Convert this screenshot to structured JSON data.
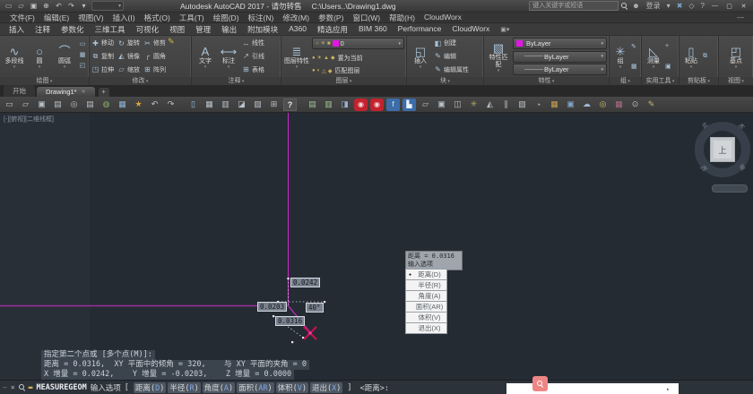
{
  "window": {
    "title": "Autodesk AutoCAD 2017 - 请勿转售",
    "doc_path": "C:\\Users..\\Drawing1.dwg",
    "search_placeholder": "键入关键字或短语",
    "signin": "登录",
    "user_icon": "☻",
    "caret": "▾",
    "x_icon": "✖",
    "cube_icon": "◇",
    "help": "?",
    "min": "—",
    "max": "▢",
    "close": "✕",
    "menubar_min": "—"
  },
  "quick_access": [
    {
      "g": "▭"
    },
    {
      "g": "▱"
    },
    {
      "g": "▣"
    },
    {
      "g": "⊕"
    },
    {
      "g": "↶"
    },
    {
      "g": "↷"
    },
    {
      "g": "▾"
    }
  ],
  "menu": {
    "items": [
      "文件(F)",
      "编辑(E)",
      "视图(V)",
      "插入(I)",
      "格式(O)",
      "工具(T)",
      "绘图(D)",
      "标注(N)",
      "修改(M)",
      "参数(P)",
      "窗口(W)",
      "帮助(H)",
      "CloudWorx"
    ]
  },
  "ribbon": {
    "tabs": [
      "插入",
      "注释",
      "参数化",
      "三维工具",
      "可视化",
      "视图",
      "管理",
      "输出",
      "附加模块",
      "A360",
      "精选应用",
      "BIM 360",
      "Performance",
      "CloudWorx"
    ],
    "extra_icon": "▣▾",
    "panels": {
      "draw": {
        "title": "绘图",
        "big": [
          {
            "icon": "∿",
            "label": "多段线"
          },
          {
            "icon": "○",
            "label": "圆"
          },
          {
            "icon": "⌒",
            "label": "圆弧"
          }
        ],
        "grid": [
          "▭",
          "◇",
          "▦",
          "⊙",
          "◰",
          "▤"
        ]
      },
      "modify": {
        "title": "修改",
        "side_icon": "✎",
        "items": [
          {
            "icon": "✚",
            "label": "移动"
          },
          {
            "icon": "⧉",
            "label": "复制"
          },
          {
            "icon": "◳",
            "label": "拉伸"
          },
          {
            "icon": "↻",
            "label": "旋转"
          },
          {
            "icon": "◭",
            "label": "镜像"
          },
          {
            "icon": "▱",
            "label": "缩放"
          },
          {
            "icon": "✂",
            "label": "修剪"
          },
          {
            "icon": "╭",
            "label": "圆角"
          },
          {
            "icon": "⊞",
            "label": "阵列"
          }
        ]
      },
      "annotate": {
        "title": "注释",
        "big": [
          {
            "icon": "A",
            "label": "文字"
          },
          {
            "icon": "⟷",
            "label": "标注"
          }
        ],
        "small": [
          {
            "icon": "↔",
            "label": "线性"
          },
          {
            "icon": "↗",
            "label": "引线"
          },
          {
            "icon": "⊞",
            "label": "表格"
          }
        ]
      },
      "layers": {
        "title": "图层",
        "big": {
          "icon": "≣",
          "label": "图层特性"
        },
        "dropdown": {
          "icons": [
            "○",
            "☀",
            "■"
          ],
          "swatch": "#e316e3",
          "value": "0"
        },
        "strip1": [
          "●",
          "☀",
          "▲",
          "◆"
        ],
        "strip2": [
          "●",
          "◐",
          "△",
          "◆"
        ],
        "btn1": "置为当前",
        "btn2": "匹配图层"
      },
      "block": {
        "title": "块",
        "big": {
          "icon": "◱",
          "label": "插入"
        },
        "small": [
          {
            "icon": "◧",
            "label": "创建"
          },
          {
            "icon": "✎",
            "label": "编辑"
          },
          {
            "icon": "✎",
            "label": "编辑属性"
          }
        ]
      },
      "properties": {
        "title": "特性",
        "big": {
          "icon": "▧",
          "label": "特性匹配"
        },
        "rows": [
          {
            "swatch": "#e316e3",
            "value": "ByLayer"
          },
          {
            "line": "————",
            "value": "ByLayer"
          },
          {
            "line": "————",
            "value": "ByLayer"
          }
        ]
      },
      "groups": {
        "title": "组",
        "big": {
          "icon": "✳",
          "label": "组"
        },
        "small": [
          "✎",
          "▦"
        ]
      },
      "utilities": {
        "title": "实用工具",
        "big": {
          "icon": "◺",
          "label": "测量"
        },
        "small": [
          "+",
          "▣"
        ]
      },
      "clipboard": {
        "title": "剪贴板",
        "big": {
          "icon": "▯",
          "label": "粘贴"
        },
        "small": [
          "⧉"
        ]
      },
      "view": {
        "title": "视图",
        "big": {
          "icon": "◰",
          "label": "基点"
        }
      }
    }
  },
  "file_tabs": {
    "start": "开始",
    "active": "Drawing1*",
    "close_glyph": "✕",
    "add_glyph": "+"
  },
  "toolbar": {
    "icons": [
      {
        "g": "▭"
      },
      {
        "g": "▱"
      },
      {
        "g": "▣"
      },
      {
        "g": "▤"
      },
      {
        "g": "◎"
      },
      {
        "g": "▤"
      },
      {
        "g": "◍",
        "c": "#86b06a"
      },
      {
        "g": "▦",
        "c": "#8fb4d8"
      },
      {
        "g": "★",
        "c": "#d9a33c"
      },
      {
        "g": "↶",
        "c": "#b9c6d4"
      },
      {
        "g": "↷",
        "c": "#b9c6d4"
      },
      {
        "cls": "sep"
      },
      {
        "g": "▯",
        "c": "#9ec1e0"
      },
      {
        "g": "▦"
      },
      {
        "g": "▥"
      },
      {
        "g": "◪"
      },
      {
        "g": "▨"
      },
      {
        "g": "⊞"
      },
      {
        "g": "?",
        "cls": "hl"
      },
      {
        "cls": "sep"
      },
      {
        "g": "▤",
        "c": "#9ac88f"
      },
      {
        "g": "▥",
        "c": "#9ac88f"
      },
      {
        "g": "◨",
        "c": "#9ab0d0"
      },
      {
        "g": "◉",
        "cls": "red"
      },
      {
        "g": "◉",
        "cls": "red"
      },
      {
        "g": "f",
        "cls": "blue"
      },
      {
        "g": "▙",
        "cls": "blue"
      },
      {
        "g": "▱"
      },
      {
        "g": "▣"
      },
      {
        "g": "◫"
      },
      {
        "g": "✳",
        "c": "#b8a860"
      },
      {
        "g": "◭"
      },
      {
        "g": "∥"
      },
      {
        "g": "▧"
      },
      {
        "g": "◔"
      },
      {
        "g": "▦",
        "c": "#c9a14e"
      },
      {
        "g": "▣",
        "c": "#7fa3c8"
      },
      {
        "g": "☁",
        "c": "#9fb9d6"
      },
      {
        "g": "◎",
        "c": "#d0c060"
      },
      {
        "g": "▦",
        "c": "#b06a8a"
      },
      {
        "g": "⊙"
      },
      {
        "g": "✎",
        "c": "#c8b47a"
      }
    ]
  },
  "drawing": {
    "viewport_label": "[-][俯视][二维线框]",
    "meas": {
      "dx": "0.0242",
      "dy": "0.0203",
      "dist": "0.0316",
      "angle": "40°"
    }
  },
  "dyn_input": {
    "header_line1": "距离 = 0.0316",
    "header_line2": "输入选项",
    "items": [
      {
        "text": "距离(D)",
        "bullet": "●"
      },
      {
        "text": "半径(R)"
      },
      {
        "text": "角度(A)"
      },
      {
        "text": "面积(AR)"
      },
      {
        "text": "体积(V)"
      },
      {
        "text": "退出(X)"
      }
    ]
  },
  "viewcube": {
    "face": "上",
    "compass": [
      "北",
      "东",
      "南",
      "西"
    ]
  },
  "cmd_history": {
    "lines": [
      "指定第二个点或 [多个点(M)]:",
      "距离 = 0.0316,  XY 平面中的倾角 = 320,    与 XY 平面的夹角 = 0",
      "X 增量 = 0.0242,    Y 增量 = -0.0203,    Z 增量 = 0.0000"
    ]
  },
  "command_line": {
    "dash": "—",
    "close": "✕",
    "pencil": "▬",
    "command": "MEASUREGEOM",
    "prompt": "输入选项",
    "open_bracket": "[",
    "options": [
      {
        "label": "距离",
        "key": "D"
      },
      {
        "label": "半径",
        "key": "R"
      },
      {
        "label": "角度",
        "key": "A"
      },
      {
        "label": "面积",
        "key": "AR"
      },
      {
        "label": "体积",
        "key": "V"
      },
      {
        "label": "退出",
        "key": "X"
      }
    ],
    "close_bracket": "]",
    "tail": " <距离>:",
    "strip_arrow": "▴"
  }
}
